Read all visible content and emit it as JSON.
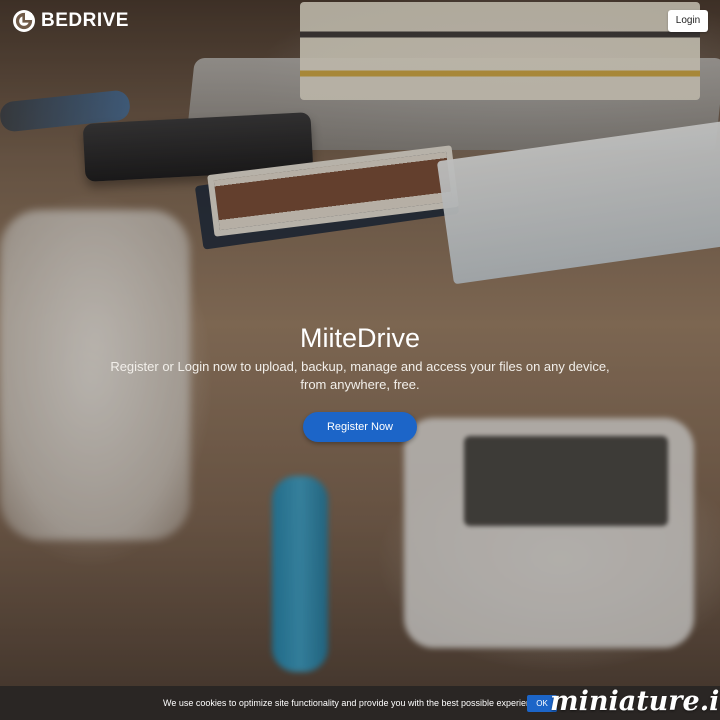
{
  "header": {
    "logo_text": "BEDRIVE",
    "login_label": "Login"
  },
  "hero": {
    "title": "MiiteDrive",
    "subtitle": "Register or Login now to upload, backup, manage and access your files on any device, from anywhere, free.",
    "register_label": "Register Now"
  },
  "cookie_bar": {
    "message": "We use cookies to optimize site functionality and provide you with the best possible experience.",
    "ok_label": "OK"
  },
  "watermark": {
    "text": "miniature.io"
  },
  "colors": {
    "accent": "#1c65c8",
    "cookie_bar_bg": "#2a2624",
    "login_bg": "#ffffff"
  },
  "icons": {
    "logo": "bedrive-logo-icon"
  }
}
